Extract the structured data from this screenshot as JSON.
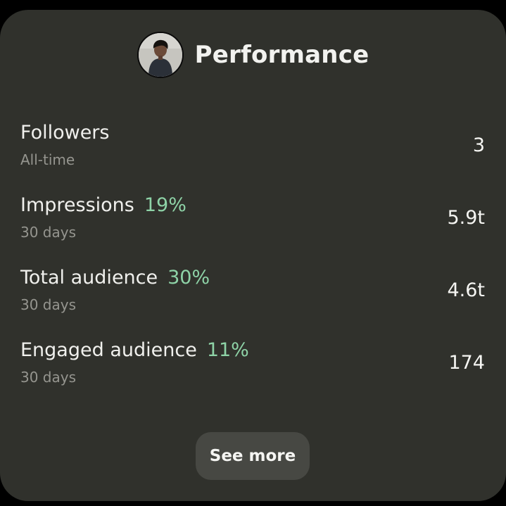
{
  "header": {
    "title": "Performance"
  },
  "metrics": [
    {
      "label": "Followers",
      "change": "",
      "period": "All-time",
      "value": "3"
    },
    {
      "label": "Impressions",
      "change": "19%",
      "period": "30 days",
      "value": "5.9t"
    },
    {
      "label": "Total audience",
      "change": "30%",
      "period": "30 days",
      "value": "4.6t"
    },
    {
      "label": "Engaged audience",
      "change": "11%",
      "period": "30 days",
      "value": "174"
    }
  ],
  "actions": {
    "see_more_label": "See more"
  },
  "colors": {
    "card_background": "#30312c",
    "positive_change": "#8ed3a7",
    "secondary_text": "#95958f",
    "button_background": "#474843"
  }
}
